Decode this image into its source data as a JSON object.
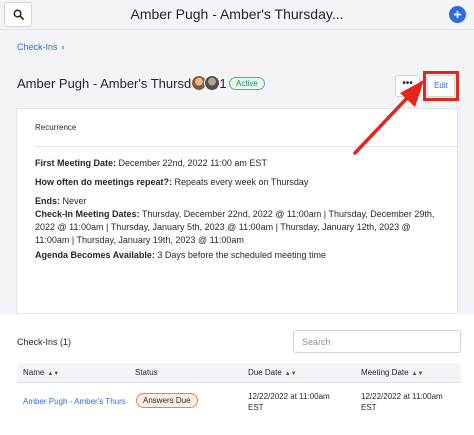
{
  "topbar": {
    "title": "Amber Pugh - Amber's Thursday...",
    "search_icon": "search-icon",
    "add_icon": "plus-icon"
  },
  "breadcrumb": {
    "link": "Check-Ins",
    "separator": "›"
  },
  "header": {
    "title": "Amber Pugh - Amber's Thursday 1:1",
    "status": "Active",
    "more_label": "•••",
    "edit_label": "Edit"
  },
  "recurrence": {
    "heading": "Recurrence",
    "first_meeting_label": "First Meeting Date:",
    "first_meeting_value": " December 22nd, 2022 11:00 am EST",
    "repeat_label": "How often do meetings repeat?:",
    "repeat_value": " Repeats every week on Thursday",
    "ends_label": "Ends:",
    "ends_value": " Never",
    "dates_label": "Check-In Meeting Dates:",
    "dates_value": " Thursday, December 22nd, 2022 @ 11:00am | Thursday, December 29th, 2022 @ 11:00am | Thursday, January 5th, 2023 @ 11:00am | Thursday, January 12th, 2023 @ 11:00am | Thursday, January 19th, 2023 @ 11:00am",
    "agenda_label": "Agenda Becomes Available:",
    "agenda_value": " 3 Days before the scheduled meeting time"
  },
  "checkins": {
    "title": "Check-Ins (1)",
    "search_placeholder": "Search",
    "columns": [
      "Name",
      "Status",
      "Due Date",
      "Meeting Date"
    ],
    "rows": [
      {
        "name": "Amber Pugh - Amber's Thurs",
        "status": "Answers Due",
        "due_date": "12/22/2022 at 11:00am EST",
        "meeting_date": "12/22/2022 at 11:00am EST"
      }
    ]
  },
  "colors": {
    "accent": "#2d6cdf",
    "highlight": "#e32619",
    "active_badge": "#53b38b",
    "due_badge": "#e6834a"
  }
}
